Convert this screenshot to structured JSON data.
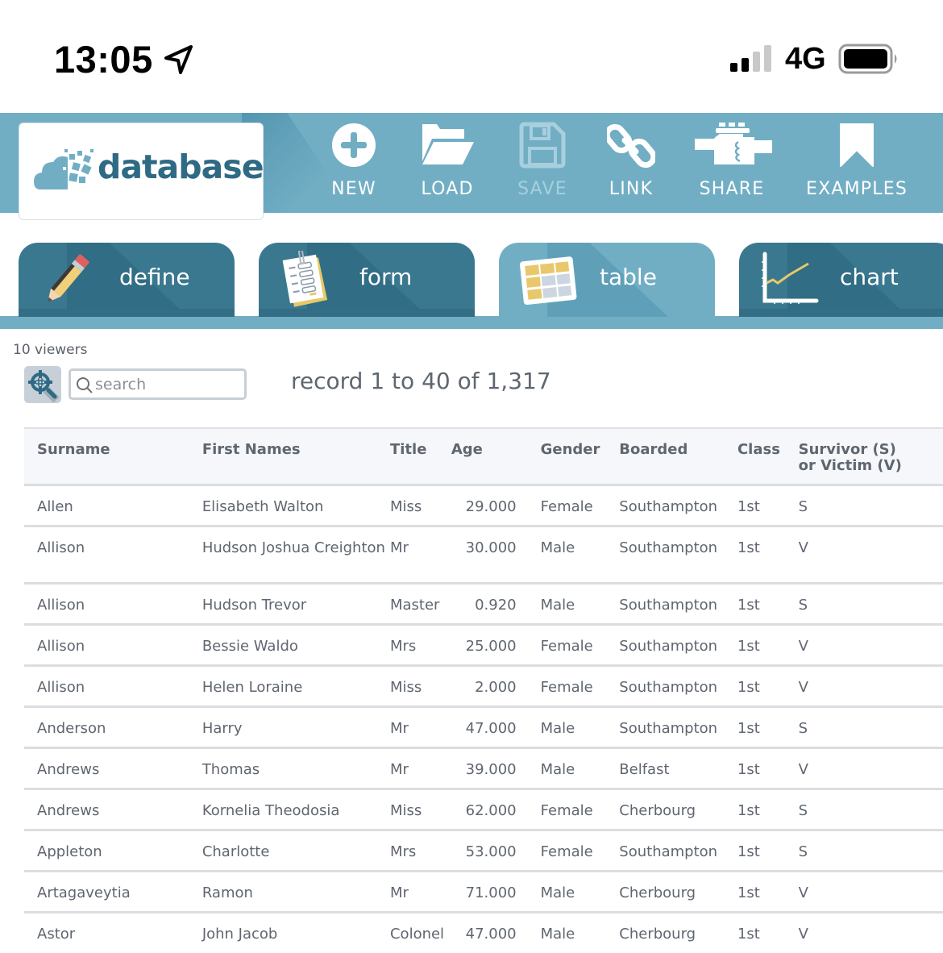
{
  "status_bar": {
    "time": "13:05",
    "location_icon": "location-arrow-icon",
    "network": "4G",
    "signal_bars_active": 2,
    "signal_bars_total": 4,
    "battery_level": 0.95
  },
  "toolbar": {
    "logo_text": "database",
    "buttons": [
      {
        "label": "NEW",
        "icon": "plus-circle-icon",
        "enabled": true
      },
      {
        "label": "LOAD",
        "icon": "folder-open-icon",
        "enabled": true
      },
      {
        "label": "SAVE",
        "icon": "floppy-disk-icon",
        "enabled": false
      },
      {
        "label": "LINK",
        "icon": "chain-link-icon",
        "enabled": true
      },
      {
        "label": "SHARE",
        "icon": "handshake-icon",
        "enabled": true
      },
      {
        "label": "EXAMPLES",
        "icon": "bookmark-icon",
        "enabled": true
      }
    ]
  },
  "tabs": [
    {
      "label": "define",
      "icon": "pencil-icon",
      "active": false
    },
    {
      "label": "form",
      "icon": "clipped-form-icon",
      "active": false
    },
    {
      "label": "table",
      "icon": "table-grid-icon",
      "active": true
    },
    {
      "label": "chart",
      "icon": "line-chart-icon",
      "active": false
    }
  ],
  "controls": {
    "viewers": "10 viewers",
    "search_placeholder": "search",
    "search_value": "",
    "record_count": "record 1 to 40 of 1,317"
  },
  "table": {
    "columns": [
      "Surname",
      "First Names",
      "Title",
      "Age",
      "Gender",
      "Boarded",
      "Class",
      "Survivor (S) or Victim (V)"
    ],
    "rows": [
      [
        "Allen",
        "Elisabeth Walton",
        "Miss",
        "29.000",
        "Female",
        "Southampton",
        "1st",
        "S"
      ],
      [
        "Allison",
        "Hudson Joshua Creighton",
        "Mr",
        "30.000",
        "Male",
        "Southampton",
        "1st",
        "V"
      ],
      [
        "Allison",
        "Hudson Trevor",
        "Master",
        "0.920",
        "Male",
        "Southampton",
        "1st",
        "S"
      ],
      [
        "Allison",
        "Bessie Waldo",
        "Mrs",
        "25.000",
        "Female",
        "Southampton",
        "1st",
        "V"
      ],
      [
        "Allison",
        "Helen Loraine",
        "Miss",
        "2.000",
        "Female",
        "Southampton",
        "1st",
        "V"
      ],
      [
        "Anderson",
        "Harry",
        "Mr",
        "47.000",
        "Male",
        "Southampton",
        "1st",
        "S"
      ],
      [
        "Andrews",
        "Thomas",
        "Mr",
        "39.000",
        "Male",
        "Belfast",
        "1st",
        "V"
      ],
      [
        "Andrews",
        "Kornelia Theodosia",
        "Miss",
        "62.000",
        "Female",
        "Cherbourg",
        "1st",
        "S"
      ],
      [
        "Appleton",
        "Charlotte",
        "Mrs",
        "53.000",
        "Female",
        "Southampton",
        "1st",
        "S"
      ],
      [
        "Artagaveytia",
        "Ramon",
        "Mr",
        "71.000",
        "Male",
        "Cherbourg",
        "1st",
        "V"
      ],
      [
        "Astor",
        "John Jacob",
        "Colonel",
        "47.000",
        "Male",
        "Cherbourg",
        "1st",
        "V"
      ]
    ]
  },
  "colors": {
    "toolbar_bg": "#71aec4",
    "tab_inactive": "#3a7890",
    "tab_active": "#71aec4",
    "logo_text": "#2f6a84",
    "table_text": "#5f6670",
    "header_bg": "#f5f7fa"
  }
}
